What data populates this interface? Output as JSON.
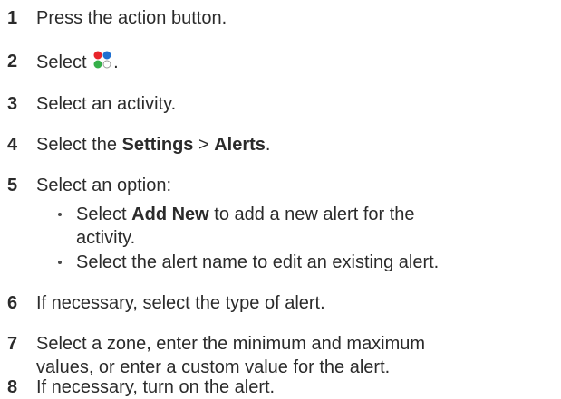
{
  "steps": [
    {
      "num": "1",
      "text": "Press the action button."
    },
    {
      "num": "2",
      "before": "Select ",
      "after": ".",
      "icon": "menu-dots-icon"
    },
    {
      "num": "3",
      "text": "Select an activity."
    },
    {
      "num": "4",
      "before": "Select the ",
      "bold1": "Settings",
      "mid": " > ",
      "bold2": "Alerts",
      "after": "."
    },
    {
      "num": "5",
      "text": "Select an option:"
    },
    {
      "num": "6",
      "text": "If necessary, select the type of alert."
    },
    {
      "num": "7",
      "line1": "Select a zone, enter the minimum and maximum",
      "line2": "values, or enter a custom value for the alert."
    },
    {
      "num": "8",
      "text": "If necessary, turn on the alert."
    }
  ],
  "bullets": [
    {
      "before": "Select ",
      "bold": "Add New",
      "after": " to add a new alert for the",
      "line2": "activity."
    },
    {
      "text": "Select the alert name to edit an existing alert."
    }
  ],
  "icon_colors": {
    "red": "#e8242a",
    "blue": "#1f6fd1",
    "green": "#36b04a",
    "empty": "#ffffff"
  }
}
